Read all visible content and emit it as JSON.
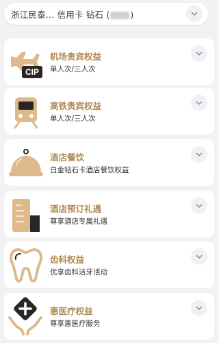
{
  "selector": {
    "prefix": "浙江民泰...  信用卡  钻石 (",
    "suffix": ")"
  },
  "benefits": [
    {
      "title": "机场贵宾权益",
      "subtitle": "单人次/三人次",
      "icon": "airplane-cip-icon"
    },
    {
      "title": "高铁贵宾权益",
      "subtitle": "单人次/三人次",
      "icon": "train-icon"
    },
    {
      "title": "酒店餐饮",
      "subtitle": "白金钻石卡酒店餐饮权益",
      "icon": "food-cloche-icon"
    },
    {
      "title": "酒店预订礼遇",
      "subtitle": "尊享酒店专属礼遇",
      "icon": "hotel-building-icon"
    },
    {
      "title": "齿科权益",
      "subtitle": "优享齿科洁牙活动",
      "icon": "tooth-icon"
    },
    {
      "title": "惠医疗权益",
      "subtitle": "尊享惠医疗服务",
      "icon": "medical-hands-icon"
    }
  ],
  "cip_text": "CIP",
  "colors": {
    "accent": "#b38a55",
    "icon_fill": "#ddb98c",
    "icon_dark": "#2a2623"
  }
}
